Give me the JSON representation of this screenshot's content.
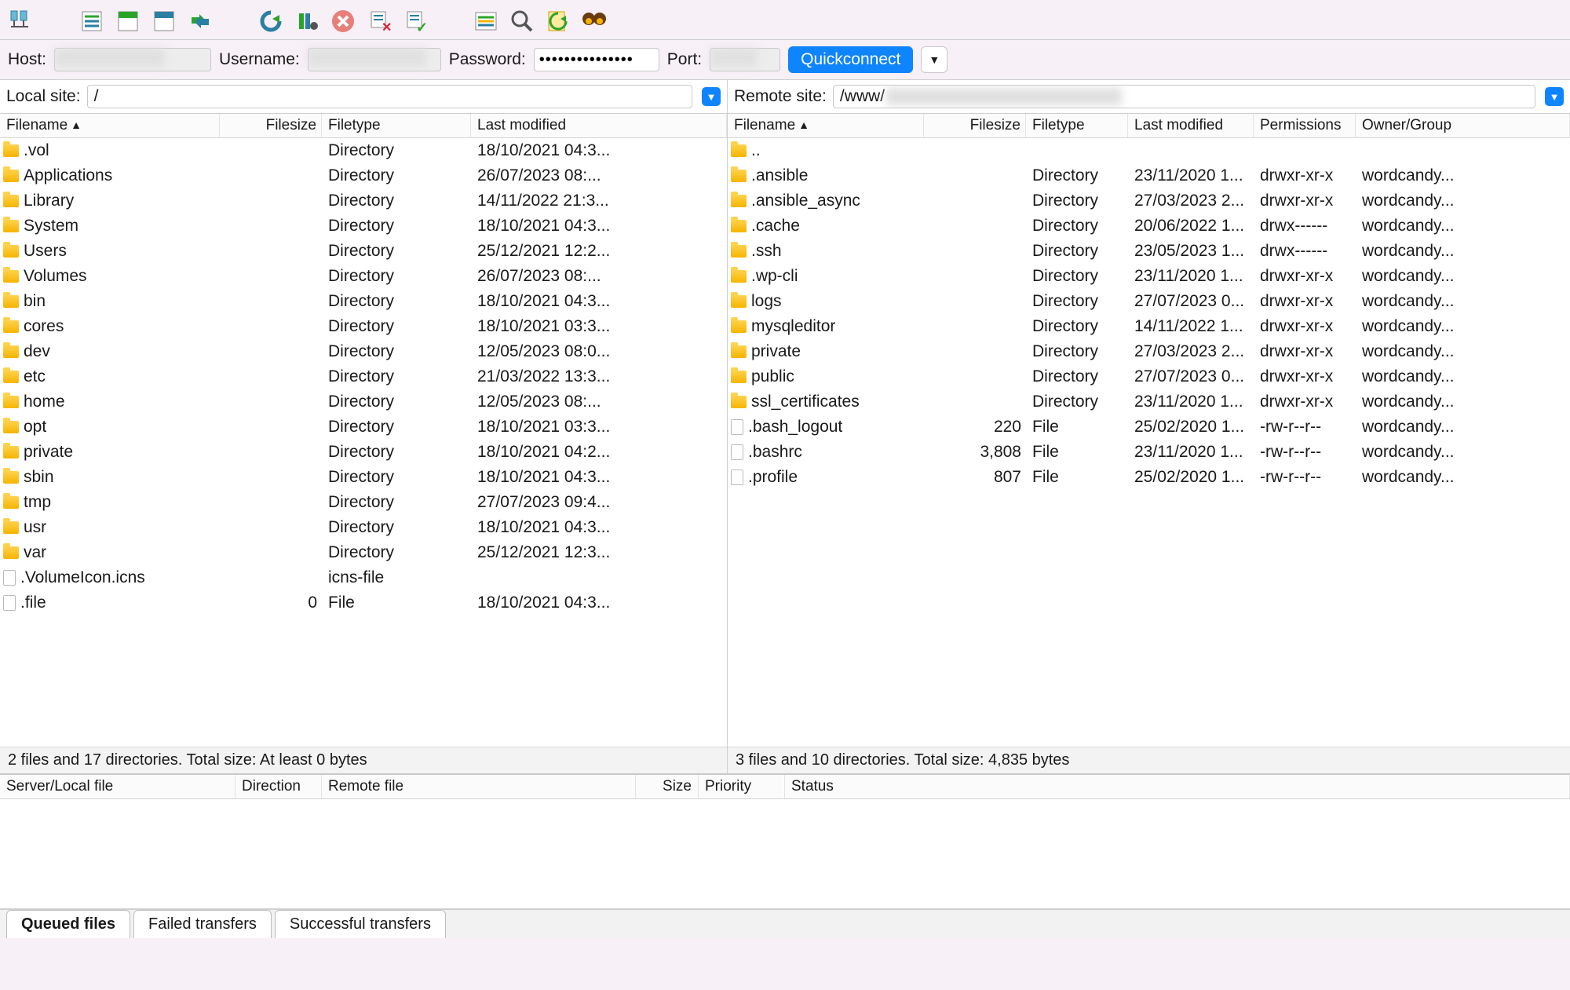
{
  "quickconnect": {
    "host_label": "Host:",
    "username_label": "Username:",
    "password_label": "Password:",
    "port_label": "Port:",
    "button": "Quickconnect",
    "password_value": "●●●●●●●●●●●●●●●"
  },
  "local": {
    "label": "Local site:",
    "path": "/",
    "columns": {
      "name": "Filename",
      "size": "Filesize",
      "type": "Filetype",
      "modified": "Last modified"
    },
    "status": "2 files and 17 directories. Total size: At least 0 bytes",
    "rows": [
      {
        "icon": "folder",
        "name": ".vol",
        "size": "",
        "type": "Directory",
        "mod": "18/10/2021 04:3..."
      },
      {
        "icon": "folder",
        "name": "Applications",
        "size": "",
        "type": "Directory",
        "mod": "26/07/2023 08:..."
      },
      {
        "icon": "folder",
        "name": "Library",
        "size": "",
        "type": "Directory",
        "mod": "14/11/2022 21:3..."
      },
      {
        "icon": "folder",
        "name": "System",
        "size": "",
        "type": "Directory",
        "mod": "18/10/2021 04:3..."
      },
      {
        "icon": "folder",
        "name": "Users",
        "size": "",
        "type": "Directory",
        "mod": "25/12/2021 12:2..."
      },
      {
        "icon": "folder",
        "name": "Volumes",
        "size": "",
        "type": "Directory",
        "mod": "26/07/2023 08:..."
      },
      {
        "icon": "folder",
        "name": "bin",
        "size": "",
        "type": "Directory",
        "mod": "18/10/2021 04:3..."
      },
      {
        "icon": "folder",
        "name": "cores",
        "size": "",
        "type": "Directory",
        "mod": "18/10/2021 03:3..."
      },
      {
        "icon": "folder",
        "name": "dev",
        "size": "",
        "type": "Directory",
        "mod": "12/05/2023 08:0..."
      },
      {
        "icon": "folder",
        "name": "etc",
        "size": "",
        "type": "Directory",
        "mod": "21/03/2022 13:3..."
      },
      {
        "icon": "folder",
        "name": "home",
        "size": "",
        "type": "Directory",
        "mod": "12/05/2023 08:..."
      },
      {
        "icon": "folder",
        "name": "opt",
        "size": "",
        "type": "Directory",
        "mod": "18/10/2021 03:3..."
      },
      {
        "icon": "folder",
        "name": "private",
        "size": "",
        "type": "Directory",
        "mod": "18/10/2021 04:2..."
      },
      {
        "icon": "folder",
        "name": "sbin",
        "size": "",
        "type": "Directory",
        "mod": "18/10/2021 04:3..."
      },
      {
        "icon": "folder",
        "name": "tmp",
        "size": "",
        "type": "Directory",
        "mod": "27/07/2023 09:4..."
      },
      {
        "icon": "folder",
        "name": "usr",
        "size": "",
        "type": "Directory",
        "mod": "18/10/2021 04:3..."
      },
      {
        "icon": "folder",
        "name": "var",
        "size": "",
        "type": "Directory",
        "mod": "25/12/2021 12:3..."
      },
      {
        "icon": "file",
        "name": ".VolumeIcon.icns",
        "size": "",
        "type": "icns-file",
        "mod": ""
      },
      {
        "icon": "file",
        "name": ".file",
        "size": "0",
        "type": "File",
        "mod": "18/10/2021 04:3..."
      }
    ]
  },
  "remote": {
    "label": "Remote site:",
    "path_prefix": "/www/",
    "columns": {
      "name": "Filename",
      "size": "Filesize",
      "type": "Filetype",
      "modified": "Last modified",
      "perm": "Permissions",
      "owner": "Owner/Group"
    },
    "status": "3 files and 10 directories. Total size: 4,835 bytes",
    "rows": [
      {
        "icon": "folder",
        "name": "..",
        "size": "",
        "type": "",
        "mod": "",
        "perm": "",
        "own": ""
      },
      {
        "icon": "folder",
        "name": ".ansible",
        "size": "",
        "type": "Directory",
        "mod": "23/11/2020 1...",
        "perm": "drwxr-xr-x",
        "own": "wordcandy..."
      },
      {
        "icon": "folder",
        "name": ".ansible_async",
        "size": "",
        "type": "Directory",
        "mod": "27/03/2023 2...",
        "perm": "drwxr-xr-x",
        "own": "wordcandy..."
      },
      {
        "icon": "folder",
        "name": ".cache",
        "size": "",
        "type": "Directory",
        "mod": "20/06/2022 1...",
        "perm": "drwx------",
        "own": "wordcandy..."
      },
      {
        "icon": "folder",
        "name": ".ssh",
        "size": "",
        "type": "Directory",
        "mod": "23/05/2023 1...",
        "perm": "drwx------",
        "own": "wordcandy..."
      },
      {
        "icon": "folder",
        "name": ".wp-cli",
        "size": "",
        "type": "Directory",
        "mod": "23/11/2020 1...",
        "perm": "drwxr-xr-x",
        "own": "wordcandy..."
      },
      {
        "icon": "folder",
        "name": "logs",
        "size": "",
        "type": "Directory",
        "mod": "27/07/2023 0...",
        "perm": "drwxr-xr-x",
        "own": "wordcandy..."
      },
      {
        "icon": "folder",
        "name": "mysqleditor",
        "size": "",
        "type": "Directory",
        "mod": "14/11/2022 1...",
        "perm": "drwxr-xr-x",
        "own": "wordcandy..."
      },
      {
        "icon": "folder",
        "name": "private",
        "size": "",
        "type": "Directory",
        "mod": "27/03/2023 2...",
        "perm": "drwxr-xr-x",
        "own": "wordcandy..."
      },
      {
        "icon": "folder",
        "name": "public",
        "size": "",
        "type": "Directory",
        "mod": "27/07/2023 0...",
        "perm": "drwxr-xr-x",
        "own": "wordcandy..."
      },
      {
        "icon": "folder",
        "name": "ssl_certificates",
        "size": "",
        "type": "Directory",
        "mod": "23/11/2020 1...",
        "perm": "drwxr-xr-x",
        "own": "wordcandy..."
      },
      {
        "icon": "file",
        "name": ".bash_logout",
        "size": "220",
        "type": "File",
        "mod": "25/02/2020 1...",
        "perm": "-rw-r--r--",
        "own": "wordcandy..."
      },
      {
        "icon": "file",
        "name": ".bashrc",
        "size": "3,808",
        "type": "File",
        "mod": "23/11/2020 1...",
        "perm": "-rw-r--r--",
        "own": "wordcandy..."
      },
      {
        "icon": "file",
        "name": ".profile",
        "size": "807",
        "type": "File",
        "mod": "25/02/2020 1...",
        "perm": "-rw-r--r--",
        "own": "wordcandy..."
      }
    ]
  },
  "queue": {
    "columns": {
      "server": "Server/Local file",
      "direction": "Direction",
      "remote": "Remote file",
      "size": "Size",
      "priority": "Priority",
      "status": "Status"
    }
  },
  "tabs": {
    "queued": "Queued files",
    "failed": "Failed transfers",
    "successful": "Successful transfers"
  }
}
